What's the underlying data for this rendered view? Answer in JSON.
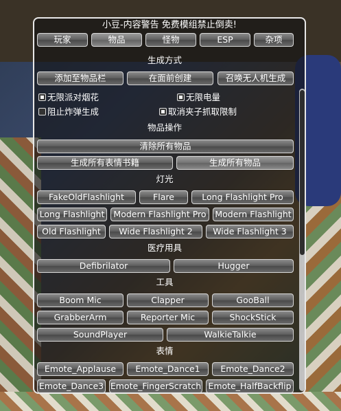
{
  "title": "小豆-内容警告 免费模组禁止倒卖!",
  "tabs": [
    {
      "label": "玩家"
    },
    {
      "label": "物品"
    },
    {
      "label": "怪物"
    },
    {
      "label": "ESP"
    },
    {
      "label": "杂项"
    }
  ],
  "spawn_mode": {
    "heading": "生成方式",
    "buttons": [
      "添加至物品栏",
      "在面前创建",
      "召唤无人机生成"
    ]
  },
  "options": [
    {
      "label": "无限派对烟花",
      "checked": true
    },
    {
      "label": "无限电量",
      "checked": true
    },
    {
      "label": "阻止炸弹生成",
      "checked": false
    },
    {
      "label": "取消夹子抓取限制",
      "checked": true
    }
  ],
  "item_ops": {
    "heading": "物品操作",
    "clear_all": "清除所有物品",
    "spawn_emote_books": "生成所有表情书籍",
    "spawn_all_items": "生成所有物品"
  },
  "lights": {
    "heading": "灯光",
    "items": [
      "FakeOldFlashlight",
      "Flare",
      "Long Flashlight Pro",
      "Long Flashlight",
      "Modern Flashlight Pro",
      "Modern Flashlight",
      "Old Flashlight",
      "Wide Flashlight 2",
      "Wide Flashlight 3"
    ]
  },
  "medical": {
    "heading": "医疗用具",
    "items": [
      "Defibrilator",
      "Hugger"
    ]
  },
  "tools": {
    "heading": "工具",
    "items": [
      "Boom Mic",
      "Clapper",
      "GooBall",
      "GrabberArm",
      "Reporter Mic",
      "ShockStick",
      "SoundPlayer",
      "WalkieTalkie"
    ]
  },
  "emotes": {
    "heading": "表情",
    "items": [
      "Emote_Applause",
      "Emote_Dance1",
      "Emote_Dance2",
      "Emote_Dance3",
      "Emote_FingerScratch",
      "Emote_HalfBackflip"
    ]
  },
  "colors": {
    "panel_border": "#e8e8e8",
    "button": "#5e5e5e",
    "esp_text": "#4cff6a"
  }
}
